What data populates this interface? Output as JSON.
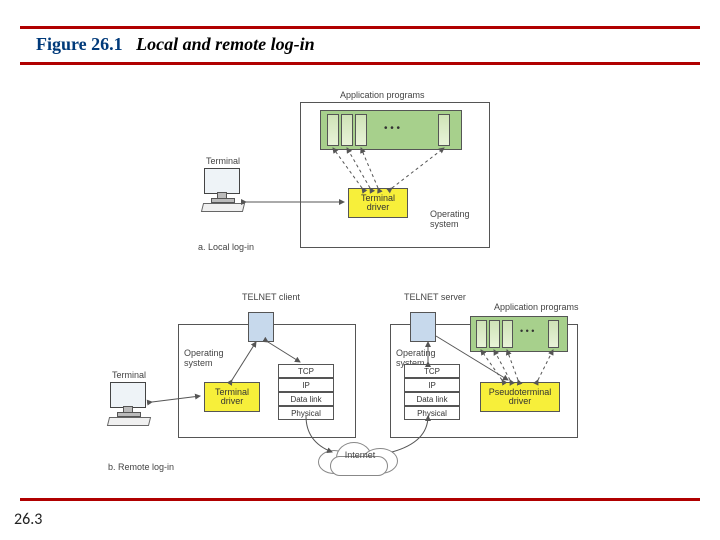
{
  "figure": {
    "number": "Figure 26.1",
    "title": "Local and remote log-in"
  },
  "page": "26.3",
  "diagA": {
    "caption": "a. Local log-in",
    "terminal": "Terminal",
    "os": "Operating system",
    "apps": "Application programs",
    "termdrv": "Terminal driver",
    "ellipsis": "• • •"
  },
  "diagB": {
    "caption": "b. Remote log-in",
    "terminal": "Terminal",
    "telnet_client": "TELNET client",
    "telnet_server": "TELNET server",
    "osL": "Operating system",
    "osR": "Operating system",
    "apps": "Application programs",
    "termdrv": "Terminal driver",
    "pseudo": "Pseudoterminal driver",
    "stack": {
      "l1": "TCP",
      "l2": "IP",
      "l3": "Data link",
      "l4": "Physical"
    },
    "internet": "Internet",
    "ellipsis": "• • •"
  }
}
